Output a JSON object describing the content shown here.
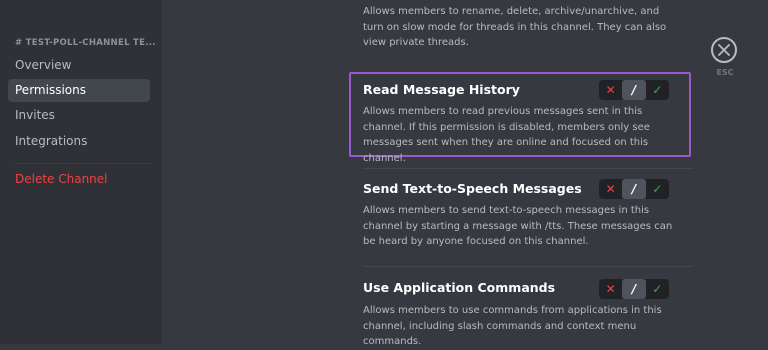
{
  "sidebar": {
    "channel_header": "# TEST-POLL-CHANNEL TE...",
    "items": [
      {
        "label": "Overview"
      },
      {
        "label": "Permissions"
      },
      {
        "label": "Invites"
      },
      {
        "label": "Integrations"
      }
    ],
    "delete_label": "Delete Channel"
  },
  "permissions": [
    {
      "title": "",
      "description": "Allows members to rename, delete, archive/unarchive, and turn on slow mode for threads in this channel. They can also view private threads."
    },
    {
      "title": "Read Message History",
      "description": "Allows members to read previous messages sent in this channel. If this permission is disabled, members only see messages sent when they are online and focused on this channel.",
      "state": "neutral"
    },
    {
      "title": "Send Text-to-Speech Messages",
      "description": "Allows members to send text-to-speech messages in this channel by starting a message with /tts. These messages can be heard by anyone focused on this channel.",
      "state": "neutral"
    },
    {
      "title": "Use Application Commands",
      "description": "Allows members to use commands from applications in this channel, including slash commands and context menu commands.",
      "state": "neutral"
    }
  ],
  "toggle": {
    "deny": "✕",
    "neutral": "/",
    "allow": "✓"
  },
  "close": {
    "label": "ESC",
    "icon": "close-icon"
  },
  "colors": {
    "background": "#36393f",
    "sidebar": "#2f3136",
    "selected": "#42464d",
    "danger": "#ed4245",
    "allow": "#3ba55c",
    "highlight": "#9b59d0"
  }
}
